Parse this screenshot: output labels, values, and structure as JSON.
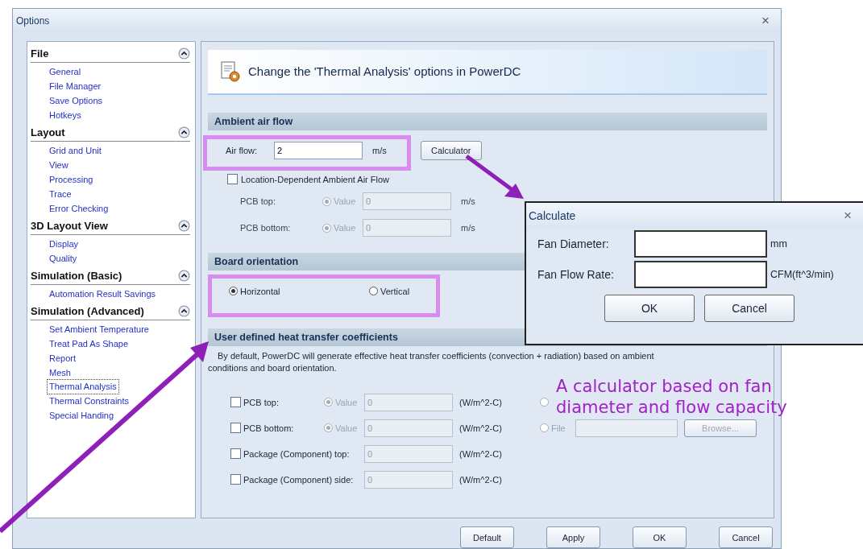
{
  "window": {
    "title": "Options",
    "close": "×"
  },
  "sidebar": {
    "groups": [
      {
        "title": "File",
        "expanded": true,
        "items": [
          {
            "label": "General",
            "selected": false
          },
          {
            "label": "File Manager",
            "selected": false
          },
          {
            "label": "Save Options",
            "selected": false
          },
          {
            "label": "Hotkeys",
            "selected": false
          }
        ]
      },
      {
        "title": "Layout",
        "expanded": true,
        "items": [
          {
            "label": "Grid and Unit",
            "selected": false
          },
          {
            "label": "View",
            "selected": false
          },
          {
            "label": "Processing",
            "selected": false
          },
          {
            "label": "Trace",
            "selected": false
          },
          {
            "label": "Error Checking",
            "selected": false
          }
        ]
      },
      {
        "title": "3D Layout View",
        "expanded": true,
        "items": [
          {
            "label": "Display",
            "selected": false
          },
          {
            "label": "Quality",
            "selected": false
          }
        ]
      },
      {
        "title": "Simulation (Basic)",
        "expanded": true,
        "items": [
          {
            "label": "Automation Result Savings",
            "selected": false
          }
        ]
      },
      {
        "title": "Simulation (Advanced)",
        "expanded": true,
        "items": [
          {
            "label": "Set Ambient Temperature",
            "selected": false
          },
          {
            "label": "Treat Pad As Shape",
            "selected": false
          },
          {
            "label": "Report",
            "selected": false
          },
          {
            "label": "Mesh",
            "selected": false
          },
          {
            "label": "Thermal Analysis",
            "selected": true
          },
          {
            "label": "Thermal Constraints",
            "selected": false
          },
          {
            "label": "Special Handing",
            "selected": false
          }
        ]
      }
    ]
  },
  "header": {
    "title": "Change the 'Thermal Analysis' options in PowerDC"
  },
  "ambient": {
    "title": "Ambient air flow",
    "air_flow": {
      "label": "Air flow:",
      "value": "2",
      "unit": "m/s"
    },
    "calculator": "Calculator",
    "location_dependent": {
      "label": "Location-Dependent Ambient Air Flow",
      "checked": false
    },
    "rows": [
      {
        "label": "PCB top:",
        "disabled": true,
        "option": {
          "label": "Value",
          "selected": true
        },
        "value": "0",
        "unit": "m/s"
      },
      {
        "label": "PCB bottom:",
        "disabled": true,
        "option": {
          "label": "Value",
          "selected": true
        },
        "value": "0",
        "unit": "m/s"
      }
    ]
  },
  "orientation": {
    "title": "Board orientation",
    "options": [
      {
        "label": "Horizontal",
        "selected": true
      },
      {
        "label": "Vertical",
        "selected": false
      }
    ]
  },
  "coefficients": {
    "title": "User defined heat transfer coefficients",
    "note": "By default, PowerDC will generate effective heat transfer coefficients (convection + radiation) based on ambient conditions and board orientation.",
    "rows": [
      {
        "label": "PCB top:",
        "checked": false,
        "option": {
          "label": "Value",
          "selected": true
        },
        "value": "0",
        "unit": "(W/m^2-C)",
        "file": {
          "selected": false
        }
      },
      {
        "label": "PCB bottom:",
        "checked": false,
        "option": {
          "label": "Value",
          "selected": true
        },
        "value": "0",
        "unit": "(W/m^2-C)",
        "file": {
          "selected": false,
          "label": "File",
          "browse": "Browse..."
        }
      },
      {
        "label": "Package (Component) top:",
        "checked": false,
        "value": "0",
        "unit": "(W/m^2-C)"
      },
      {
        "label": "Package (Component) side:",
        "checked": false,
        "value": "0",
        "unit": "(W/m^2-C)"
      }
    ]
  },
  "buttons": [
    "Default",
    "Apply",
    "OK",
    "Cancel"
  ],
  "calculate_dialog": {
    "title": "Calculate",
    "close": "×",
    "fields": [
      {
        "label": "Fan Diameter:",
        "unit": "mm"
      },
      {
        "label": "Fan Flow Rate:",
        "unit": "CFM(ft^3/min)"
      }
    ],
    "buttons": [
      "OK",
      "Cancel"
    ]
  },
  "annotation": {
    "caption": "A calculator based on fan diameter and flow capacity"
  }
}
